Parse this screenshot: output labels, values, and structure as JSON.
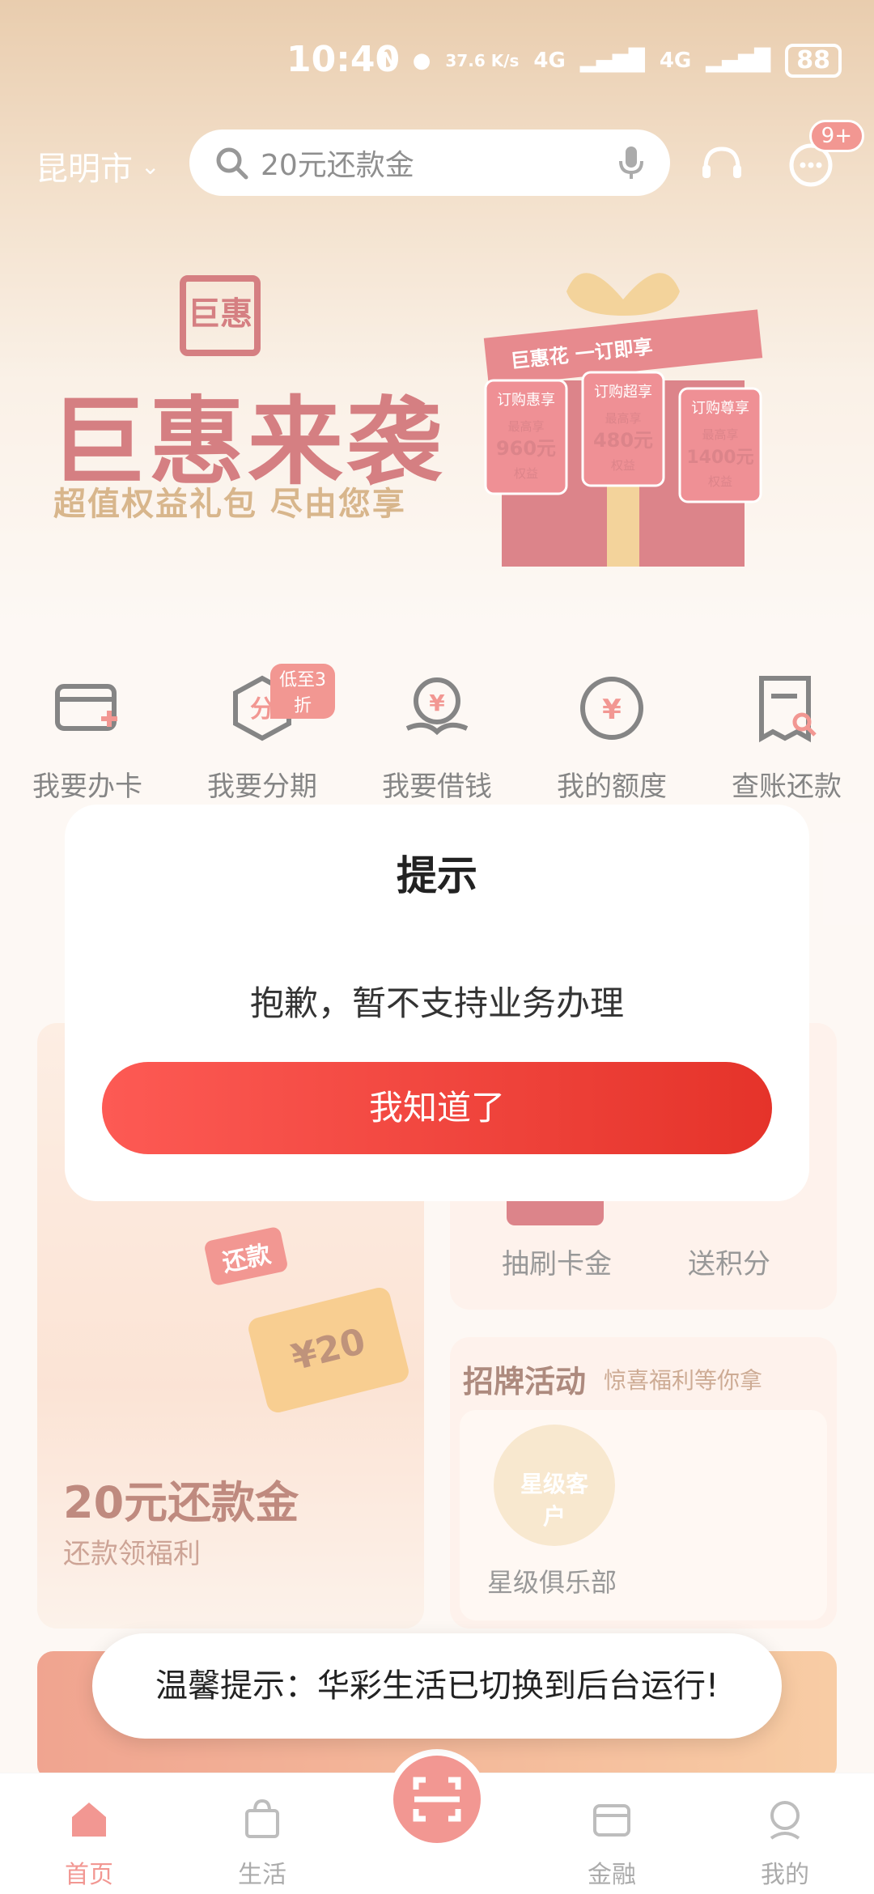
{
  "status_bar": {
    "time": "10:40",
    "net_speed": "37.6 K/s",
    "network": "4G",
    "network2": "4G",
    "battery": "88"
  },
  "header": {
    "city": "昆明市",
    "search_text": "20元还款金",
    "message_badge": "9+"
  },
  "banner": {
    "logo_text": "巨惠",
    "title": "巨惠来袭",
    "subtitle": "超值权益礼包 尽由您享",
    "ribbon": "巨惠花 一订即享",
    "boxes": [
      {
        "name": "订购惠享",
        "line1": "最高享",
        "value": "960元",
        "line3": "权益"
      },
      {
        "name": "订购超享",
        "line1": "最高享",
        "value": "480元",
        "line3": "权益"
      },
      {
        "name": "订购尊享",
        "line1": "最高享",
        "value": "1400元",
        "line3": "权益"
      }
    ]
  },
  "quick_actions": [
    {
      "label": "我要办卡"
    },
    {
      "label": "我要分期",
      "tag": "低至3折"
    },
    {
      "label": "我要借钱"
    },
    {
      "label": "我的额度"
    },
    {
      "label": "查账还款"
    }
  ],
  "cards": {
    "left": {
      "title": "20元还款金",
      "subtitle": "还款领福利",
      "coupon": "¥20",
      "stamp": "还款"
    },
    "right_top": {
      "items": [
        "抽刷卡金",
        "送积分"
      ]
    },
    "right_bottom": {
      "title": "招牌活动",
      "subtitle": "惊喜福利等你拿",
      "items": [
        "星级俱乐部"
      ],
      "badge_text": "星级客户"
    }
  },
  "dialog": {
    "title": "提示",
    "message": "抱歉，暂不支持业务办理",
    "confirm": "我知道了"
  },
  "toast": {
    "text": "温馨提示：华彩生活已切换到后台运行!"
  },
  "tabbar": {
    "items": [
      "首页",
      "生活",
      "金融",
      "我的"
    ]
  },
  "colors": {
    "accent": "#e8423a",
    "banner_red": "#b3171d",
    "header_gold": "#d7a46c"
  }
}
